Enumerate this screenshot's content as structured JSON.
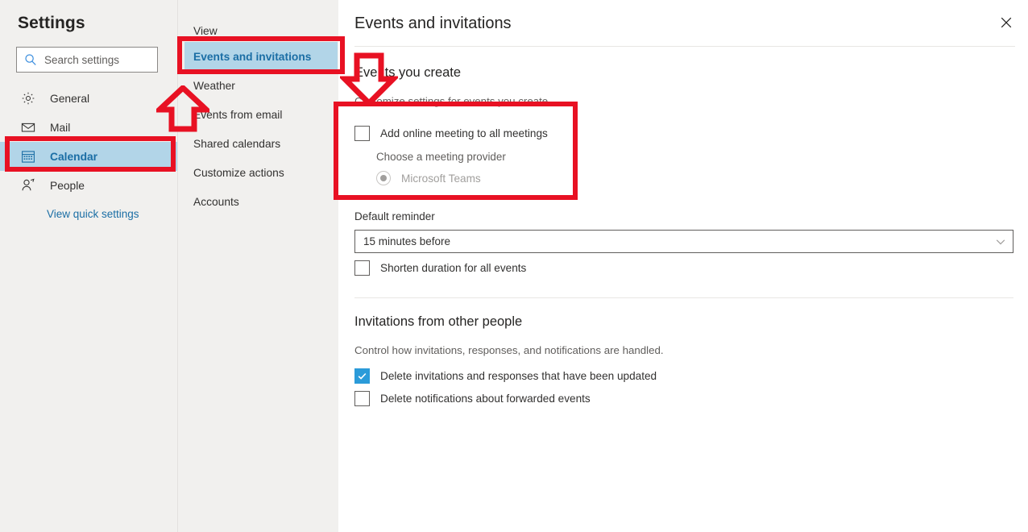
{
  "sidebar": {
    "title": "Settings",
    "search": {
      "placeholder": "Search settings",
      "icon": "search-icon"
    },
    "items": [
      {
        "label": "General",
        "icon": "gear-icon",
        "selected": false
      },
      {
        "label": "Mail",
        "icon": "envelope-icon",
        "selected": false
      },
      {
        "label": "Calendar",
        "icon": "calendar-icon",
        "selected": true
      },
      {
        "label": "People",
        "icon": "person-icon",
        "selected": false
      }
    ],
    "quick_settings_link": "View quick settings"
  },
  "subnav": {
    "items": [
      {
        "label": "View",
        "selected": false
      },
      {
        "label": "Events and invitations",
        "selected": true
      },
      {
        "label": "Weather",
        "selected": false
      },
      {
        "label": "Events from email",
        "selected": false
      },
      {
        "label": "Shared calendars",
        "selected": false
      },
      {
        "label": "Customize actions",
        "selected": false
      },
      {
        "label": "Accounts",
        "selected": false
      }
    ]
  },
  "main": {
    "title": "Events and invitations",
    "close_icon": "close-icon",
    "events_you_create": {
      "heading": "Events you create",
      "subtitle": "Customize settings for events you create.",
      "add_online_meeting": {
        "label": "Add online meeting to all meetings",
        "checked": false
      },
      "provider_label": "Choose a meeting provider",
      "provider_option": {
        "label": "Microsoft Teams",
        "selected": true,
        "disabled": true
      },
      "default_reminder": {
        "label": "Default reminder",
        "value": "15 minutes before",
        "caret_icon": "chevron-down-icon"
      },
      "shorten_duration": {
        "label": "Shorten duration for all events",
        "checked": false
      }
    },
    "invitations_from_others": {
      "heading": "Invitations from other people",
      "subtitle": "Control how invitations, responses, and notifications are handled.",
      "delete_invitations": {
        "label": "Delete invitations and responses that have been updated",
        "checked": true
      },
      "delete_notifications": {
        "label": "Delete notifications about forwarded events",
        "checked": false
      }
    }
  },
  "annotations": {
    "color": "#e81123",
    "boxes": [
      {
        "name": "calendar-nav-highlight-box"
      },
      {
        "name": "events-and-invitations-highlight-box"
      },
      {
        "name": "online-meeting-section-highlight-box"
      }
    ],
    "arrows": [
      {
        "name": "up-arrow-pointing-to-events-and-invitations",
        "direction": "up"
      },
      {
        "name": "down-arrow-pointing-to-online-meeting-section",
        "direction": "down"
      }
    ]
  },
  "colors": {
    "accent_blue": "#1b6ea5",
    "highlight_blue": "#b2d5e8",
    "checkbox_blue": "#2b9bd9",
    "annotation_red": "#e81123",
    "sidebar_bg": "#f1f0ee"
  }
}
